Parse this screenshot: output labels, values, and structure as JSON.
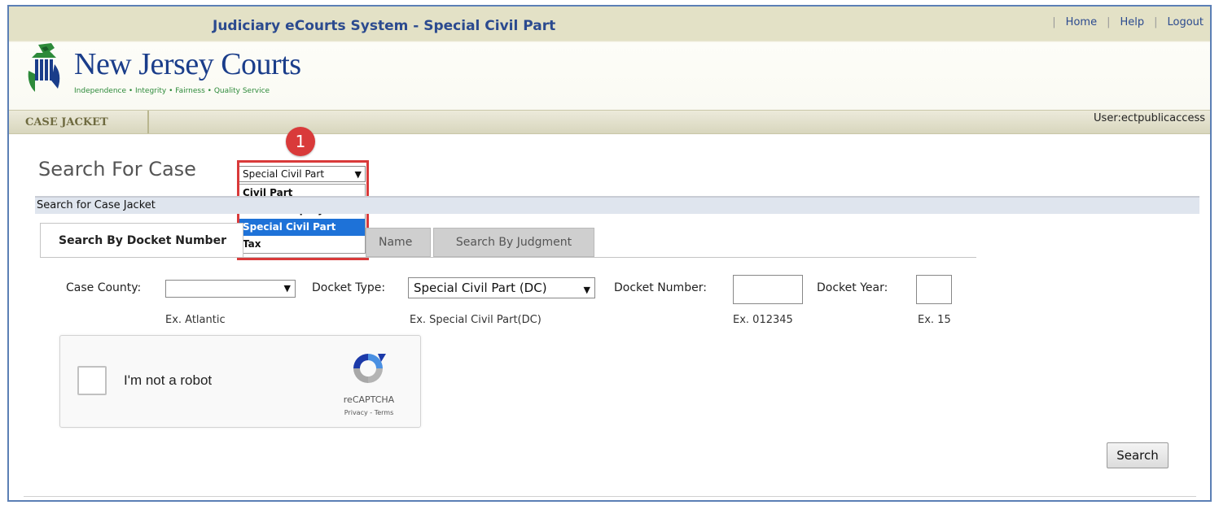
{
  "header": {
    "app_title": "Judiciary eCourts System - Special Civil Part",
    "links": [
      "Home",
      "Help",
      "Logout"
    ],
    "logo_text": "New Jersey Courts",
    "logo_tagline": "Independence • Integrity • Fairness • Quality Service"
  },
  "nav": {
    "tab": "CASE JACKET",
    "user": "User:ectpublicaccess"
  },
  "page": {
    "title": "Search For Case",
    "court_select": {
      "value": "Special Civil Part",
      "options": [
        "Civil Part",
        "General Equity",
        "Special Civil Part",
        "Tax"
      ],
      "highlighted_index": 2
    },
    "callout_number": "1",
    "section_title": "Search for Case Jacket"
  },
  "tabs": {
    "active": "Search By Docket Number",
    "name": "Name",
    "judgment": "Search By Judgment"
  },
  "form": {
    "county_label": "Case County:",
    "county_value": "",
    "county_example": "Ex. Atlantic",
    "docket_type_label": "Docket Type:",
    "docket_type_value": "Special Civil Part (DC)",
    "docket_type_example": "Ex. Special Civil Part(DC)",
    "docket_number_label": "Docket Number:",
    "docket_number_value": "",
    "docket_number_example": "Ex. 012345",
    "docket_year_label": "Docket Year:",
    "docket_year_value": "",
    "docket_year_example": "Ex. 15"
  },
  "captcha": {
    "label": "I'm not a robot",
    "brand": "reCAPTCHA",
    "links": "Privacy - Terms"
  },
  "actions": {
    "search": "Search"
  },
  "colors": {
    "header_band": "#e3e1c6",
    "title_blue": "#2b4a8f",
    "callout_red": "#d93a3a",
    "option_selected": "#1e72d8"
  }
}
